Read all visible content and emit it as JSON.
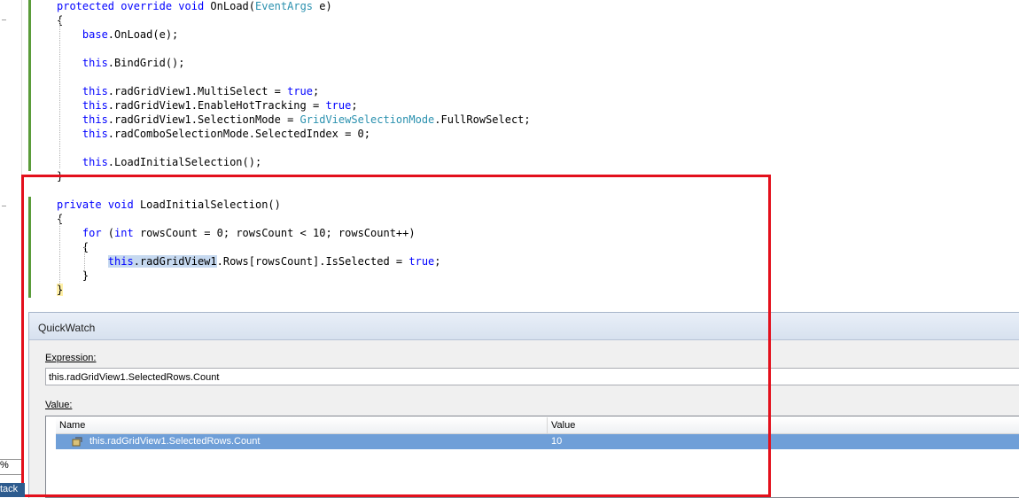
{
  "code": {
    "lines": [
      {
        "parts": [
          {
            "t": "protected",
            "c": "kw"
          },
          {
            "t": " "
          },
          {
            "t": "override",
            "c": "kw"
          },
          {
            "t": " "
          },
          {
            "t": "void",
            "c": "kw"
          },
          {
            "t": " OnLoad("
          },
          {
            "t": "EventArgs",
            "c": "ty"
          },
          {
            "t": " e)"
          }
        ]
      },
      {
        "parts": [
          {
            "t": "{"
          }
        ]
      },
      {
        "parts": [
          {
            "t": "    base",
            "c": "kw"
          },
          {
            "t": ".OnLoad(e);"
          }
        ]
      },
      {
        "parts": [
          {
            "t": ""
          }
        ]
      },
      {
        "parts": [
          {
            "t": "    this",
            "c": "kw"
          },
          {
            "t": ".BindGrid();"
          }
        ]
      },
      {
        "parts": [
          {
            "t": ""
          }
        ]
      },
      {
        "parts": [
          {
            "t": "    this",
            "c": "kw"
          },
          {
            "t": ".radGridView1.MultiSelect = "
          },
          {
            "t": "true",
            "c": "kw"
          },
          {
            "t": ";"
          }
        ]
      },
      {
        "parts": [
          {
            "t": "    this",
            "c": "kw"
          },
          {
            "t": ".radGridView1.EnableHotTracking = "
          },
          {
            "t": "true",
            "c": "kw"
          },
          {
            "t": ";"
          }
        ]
      },
      {
        "parts": [
          {
            "t": "    this",
            "c": "kw"
          },
          {
            "t": ".radGridView1.SelectionMode = "
          },
          {
            "t": "GridViewSelectionMode",
            "c": "ty"
          },
          {
            "t": ".FullRowSelect;"
          }
        ]
      },
      {
        "parts": [
          {
            "t": "    this",
            "c": "kw"
          },
          {
            "t": ".radComboSelectionMode.SelectedIndex = 0;"
          }
        ]
      },
      {
        "parts": [
          {
            "t": ""
          }
        ]
      },
      {
        "parts": [
          {
            "t": "    this",
            "c": "kw"
          },
          {
            "t": ".LoadInitialSelection();"
          }
        ]
      },
      {
        "parts": [
          {
            "t": "}"
          }
        ]
      },
      {
        "parts": [
          {
            "t": ""
          }
        ]
      },
      {
        "parts": [
          {
            "t": "private",
            "c": "kw"
          },
          {
            "t": " "
          },
          {
            "t": "void",
            "c": "kw"
          },
          {
            "t": " LoadInitialSelection()"
          }
        ]
      },
      {
        "parts": [
          {
            "t": "{"
          }
        ]
      },
      {
        "parts": [
          {
            "t": "    for",
            "c": "kw"
          },
          {
            "t": " ("
          },
          {
            "t": "int",
            "c": "kw"
          },
          {
            "t": " rowsCount = 0; rowsCount < 10; rowsCount++)"
          }
        ]
      },
      {
        "parts": [
          {
            "t": "    {"
          }
        ]
      },
      {
        "parts": [
          {
            "t": "        "
          },
          {
            "t": "this",
            "c": "kw sel-this"
          },
          {
            "t": ".radGridView1",
            "c": "sel-this"
          },
          {
            "t": ".Rows[rowsCount].IsSelected = "
          },
          {
            "t": "true",
            "c": "kw"
          },
          {
            "t": ";"
          }
        ]
      },
      {
        "parts": [
          {
            "t": "    }"
          }
        ]
      },
      {
        "parts": [
          {
            "t": "}",
            "c": "hl-brace"
          }
        ]
      }
    ]
  },
  "quickwatch": {
    "title": "QuickWatch",
    "expression_label": "Expression:",
    "expression_value": "this.radGridView1.SelectedRows.Count",
    "value_label": "Value:",
    "columns": [
      "Name",
      "Value"
    ],
    "row": {
      "name": "this.radGridView1.SelectedRows.Count",
      "value": "10",
      "icon": "property-icon"
    }
  },
  "status": {
    "zoom": "%",
    "panel": "tack"
  },
  "colors": {
    "keyword": "#0000ff",
    "type": "#2b91af",
    "annotation_box": "#e3101c",
    "selected_row": "#6f9fd8"
  }
}
